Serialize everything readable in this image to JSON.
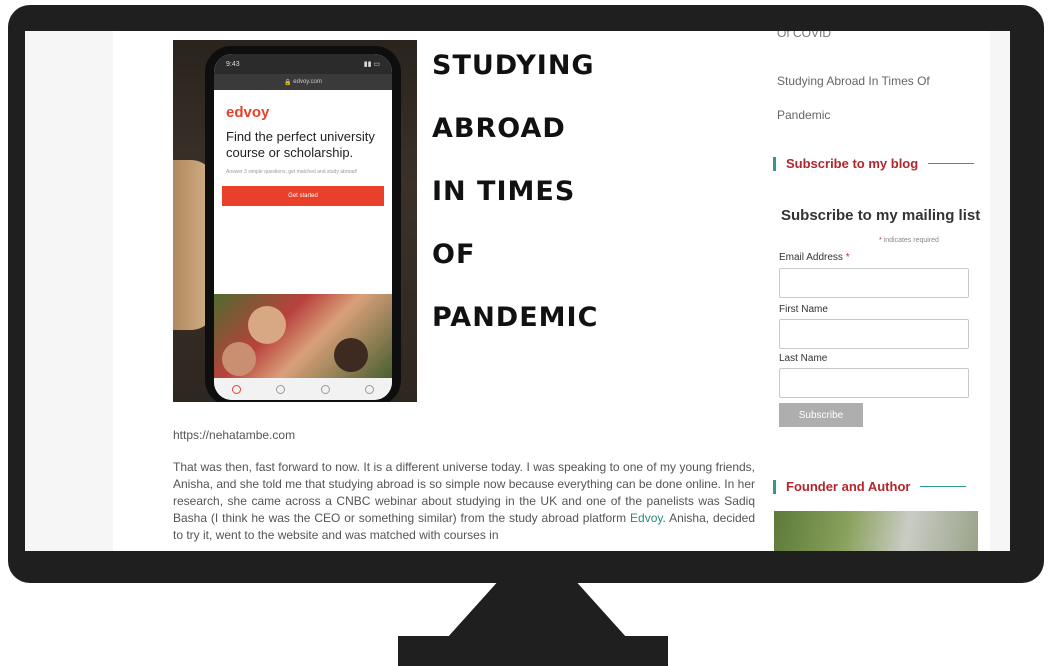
{
  "article": {
    "title_lines": [
      "STUDYING",
      "ABROAD",
      "IN TIMES",
      "OF",
      "PANDEMIC"
    ],
    "source_url": "https://nehatambe.com",
    "body_part1": "That was then, fast forward to now. It is a different universe today. I was speaking to one of my young friends, Anisha,  and she told me that studying abroad is so simple now because everything can be done online. In her research, she came across a CNBC webinar about studying in the UK and one of the panelists was Sadiq Basha (I think he was the CEO or something similar)  from the study abroad platform ",
    "body_link": "Edvoy",
    "body_part2": ".  Anisha, decided to try it, went to the website and was matched with courses in"
  },
  "phone": {
    "time": "9:43",
    "url": "edvoy.com",
    "brand": "edvoy",
    "heading": "Find the perfect university course or scholarship.",
    "subtext": "Answer 3 simple questions, get matched and study abroad!",
    "cta": "Get started",
    "nav_items": [
      "Explore",
      "Saved",
      "Chat",
      "Log in"
    ]
  },
  "sidebar": {
    "covid_fragment": "Of COVID",
    "recent_post": "Studying Abroad In Times Of Pandemic",
    "subscribe_heading": "Subscribe to my blog",
    "mailing_title": "Subscribe to my mailing list",
    "required_note": "indicates required",
    "email_label": "Email Address",
    "first_name_label": "First Name",
    "last_name_label": "Last Name",
    "subscribe_button": "Subscribe",
    "founder_heading": "Founder and Author"
  },
  "colors": {
    "accent_teal": "#2f9a8a",
    "heading_red": "#b3262b",
    "brand_red": "#e8402b"
  }
}
